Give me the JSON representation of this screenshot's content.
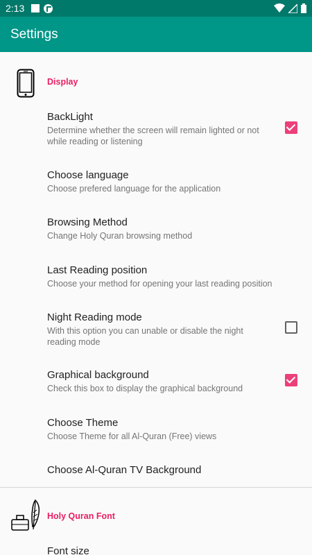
{
  "status_bar": {
    "time": "2:13"
  },
  "app_bar": {
    "title": "Settings"
  },
  "categories": [
    {
      "title": "Display"
    },
    {
      "title": "Holy Quran Font"
    }
  ],
  "prefs": [
    {
      "title": "BackLight",
      "summary": "Determine whether the screen will remain lighted or not while reading or listening",
      "checked": true
    },
    {
      "title": "Choose language",
      "summary": "Choose prefered language for the application"
    },
    {
      "title": "Browsing Method",
      "summary": "Change Holy Quran browsing method"
    },
    {
      "title": "Last Reading position",
      "summary": "Choose your method for opening your last reading position"
    },
    {
      "title": "Night Reading mode",
      "summary": "With this option you can unable or disable the night reading mode",
      "checked": false
    },
    {
      "title": "Graphical background",
      "summary": "Check this box to display the graphical background",
      "checked": true
    },
    {
      "title": "Choose Theme",
      "summary": "Choose Theme for all Al-Quran (Free) views"
    },
    {
      "title": "Choose Al-Quran TV Background",
      "summary": ""
    },
    {
      "title": "Font size",
      "summary": ""
    }
  ],
  "colors": {
    "primary": "#009688",
    "primary_dark": "#00796B",
    "accent": "#EC407A"
  }
}
